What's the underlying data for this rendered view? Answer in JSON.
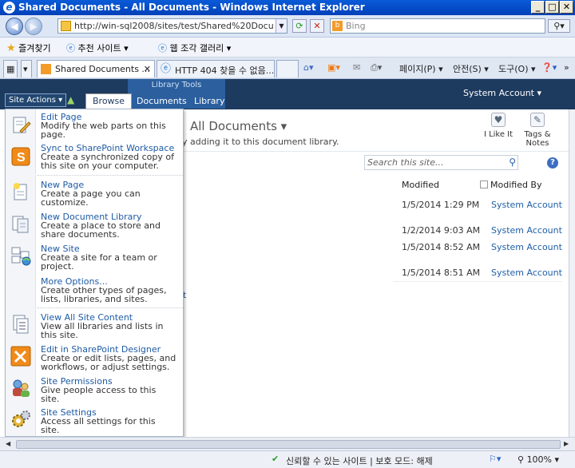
{
  "window": {
    "title": "Shared Documents - All Documents - Windows Internet Explorer"
  },
  "address": {
    "url": "http://win-sql2008/sites/test/Shared%20Document",
    "search_placeholder": "Bing"
  },
  "favorites": {
    "label": "즐겨찾기",
    "suggested": "추천 사이트 ▾",
    "gallery": "웹 조각 갤러리 ▾"
  },
  "tabs": [
    {
      "label": "Shared Documents ...",
      "close": "✕"
    },
    {
      "label": "HTTP 404 찾을 수 없음..."
    }
  ],
  "commandbar": {
    "page": "페이지(P) ▾",
    "safety": "안전(S) ▾",
    "tools": "도구(O) ▾"
  },
  "ribbon": {
    "site_actions": "Site Actions ▾",
    "browse": "Browse",
    "library_tools": "Library Tools",
    "documents": "Documents",
    "library": "Library",
    "user": "System Account ▾"
  },
  "page": {
    "title": "All Documents ▾",
    "description": "y adding it to this document library.",
    "i_like_it": "I Like It",
    "tags_notes_1": "Tags &",
    "tags_notes_2": "Notes",
    "search_placeholder": "Search this site...",
    "partial_link": "t"
  },
  "columns": {
    "modified": "Modified",
    "modified_by": "Modified By"
  },
  "rows": [
    {
      "modified": "1/5/2014 1:29 PM",
      "modified_by": "System Account"
    },
    {
      "modified": "1/2/2014 9:03 AM",
      "modified_by": "System Account"
    },
    {
      "modified": "1/5/2014 8:52 AM",
      "modified_by": "System Account"
    },
    {
      "modified": "1/5/2014 8:51 AM",
      "modified_by": "System Account"
    }
  ],
  "menu": [
    {
      "title": "Edit Page",
      "desc": "Modify the web parts on this page.",
      "icon": "edit-page-icon"
    },
    {
      "title": "Sync to SharePoint Workspace",
      "desc": "Create a synchronized copy of this site on your computer.",
      "icon": "sharepoint-workspace-icon"
    },
    {
      "title": "New Page",
      "desc": "Create a page you can customize.",
      "icon": "new-page-icon"
    },
    {
      "title": "New Document Library",
      "desc": "Create a place to store and share documents.",
      "icon": "document-library-icon"
    },
    {
      "title": "New Site",
      "desc": "Create a site for a team or project.",
      "icon": "new-site-icon"
    },
    {
      "title": "More Options...",
      "desc": "Create other types of pages, lists, libraries, and sites."
    },
    {
      "title": "View All Site Content",
      "desc": "View all libraries and lists in this site.",
      "icon": "site-content-icon"
    },
    {
      "title": "Edit in SharePoint Designer",
      "desc": "Create or edit lists, pages, and workflows, or adjust settings.",
      "icon": "designer-icon"
    },
    {
      "title": "Site Permissions",
      "desc": "Give people access to this site.",
      "icon": "permissions-icon"
    },
    {
      "title": "Site Settings",
      "desc": "Access all settings for this site.",
      "icon": "settings-gear-icon"
    }
  ],
  "status": {
    "zone": "신뢰할 수 있는 사이트 | 보호 모드: 해제",
    "zoom": "100% ▾"
  }
}
